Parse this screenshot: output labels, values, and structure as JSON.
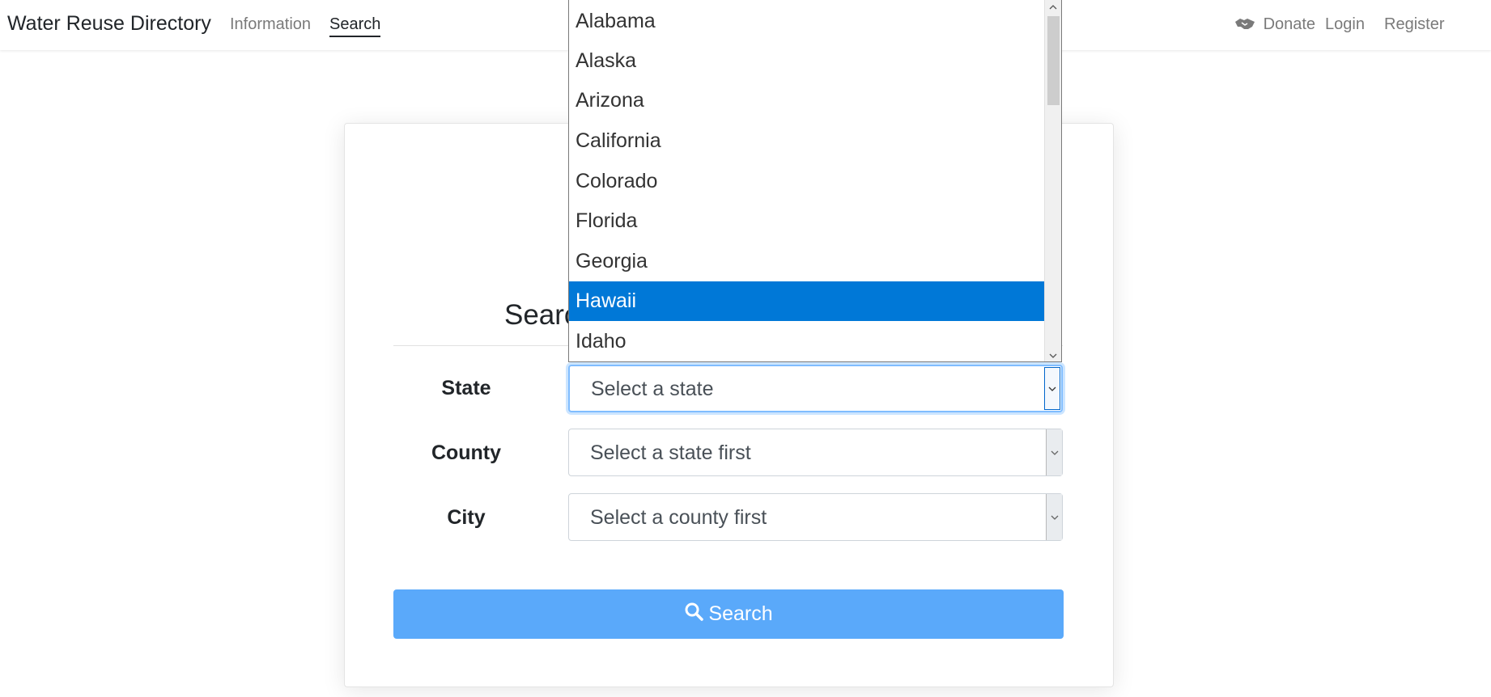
{
  "navbar": {
    "brand": "Water Reuse Directory",
    "links": [
      {
        "label": "Information",
        "active": false
      },
      {
        "label": "Search",
        "active": true
      }
    ],
    "right": {
      "donate": "Donate",
      "login": "Login",
      "register": "Register"
    }
  },
  "card": {
    "title": "Searc"
  },
  "form": {
    "state": {
      "label": "State",
      "value": "Select a state"
    },
    "county": {
      "label": "County",
      "value": "Select a state first"
    },
    "city": {
      "label": "City",
      "value": "Select a county first"
    }
  },
  "search_button": {
    "label": "Search",
    "color": "#5aa9fa"
  },
  "dropdown": {
    "options": [
      "Alabama",
      "Alaska",
      "Arizona",
      "California",
      "Colorado",
      "Florida",
      "Georgia",
      "Hawaii",
      "Idaho"
    ],
    "highlighted": "Hawaii",
    "highlight_color": "#0078d7"
  },
  "icons": {
    "donate": "handshake-icon",
    "search": "search-icon",
    "select_arrow": "chevron-down-icon"
  }
}
